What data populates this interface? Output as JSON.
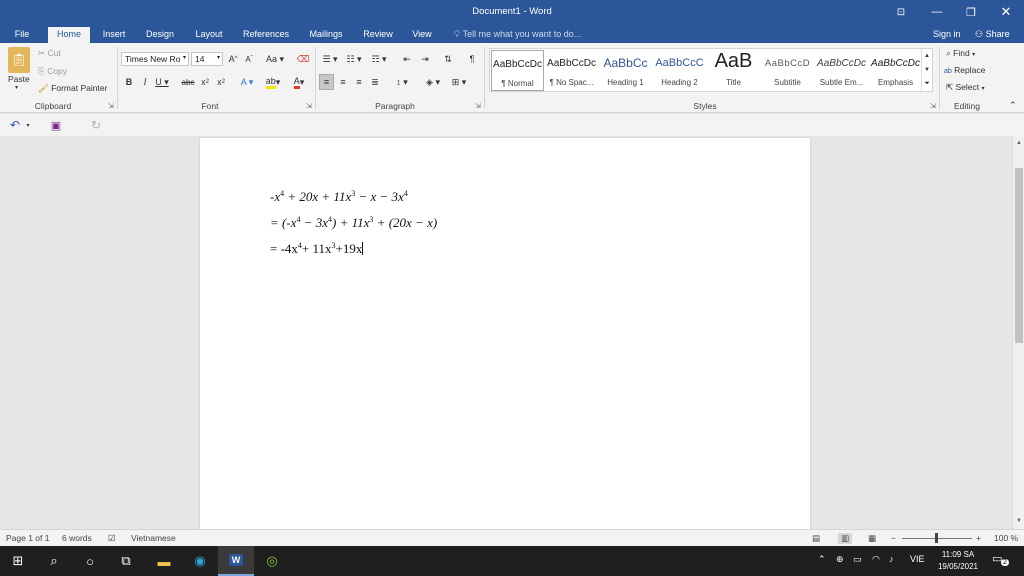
{
  "window": {
    "title": "Document1 - Word"
  },
  "tabs": [
    "File",
    "Home",
    "Insert",
    "Design",
    "Layout",
    "References",
    "Mailings",
    "Review",
    "View"
  ],
  "tell_me": "Tell me what you want to do...",
  "account": {
    "sign_in": "Sign in",
    "share": "Share"
  },
  "clipboard": {
    "paste": "Paste",
    "cut": "Cut",
    "copy": "Copy",
    "format_painter": "Format Painter",
    "label": "Clipboard"
  },
  "font": {
    "name": "Times New Ro",
    "size": "14",
    "label": "Font"
  },
  "paragraph": {
    "label": "Paragraph"
  },
  "styles": {
    "label": "Styles",
    "items": [
      {
        "sample": "AaBbCcDc",
        "name": "¶ Normal"
      },
      {
        "sample": "AaBbCcDc",
        "name": "¶ No Spac..."
      },
      {
        "sample": "AaBbCc",
        "name": "Heading 1"
      },
      {
        "sample": "AaBbCcC",
        "name": "Heading 2"
      },
      {
        "sample": "AaB",
        "name": "Title"
      },
      {
        "sample": "AaBbCcD",
        "name": "Subtitle"
      },
      {
        "sample": "AaBbCcDc",
        "name": "Subtle Em..."
      },
      {
        "sample": "AaBbCcDc",
        "name": "Emphasis"
      }
    ]
  },
  "editing": {
    "find": "Find",
    "replace": "Replace",
    "select": "Select",
    "label": "Editing"
  },
  "document": {
    "line1": {
      "a": "-x",
      "a_exp": "4",
      "b": " + 20x + 11x",
      "b_exp": "3",
      "c": " − x − 3x",
      "c_exp": "4"
    },
    "line2": {
      "a": "= (-x",
      "a_exp": "4",
      "b": " − 3x",
      "b_exp": "4",
      "c": ") + 11x",
      "c_exp": "3",
      "d": " + (20x − x)"
    },
    "line3": {
      "a": "= -4x",
      "a_exp": "4",
      "b": "+ 11x",
      "b_exp": "3",
      "c": "+19x"
    }
  },
  "status": {
    "page": "Page 1 of 1",
    "words": "6 words",
    "language": "Vietnamese",
    "zoom": "100 %"
  },
  "taskbar": {
    "lang": "VIE",
    "time": "11:09 SA",
    "date": "19/05/2021",
    "notifications": "2"
  }
}
